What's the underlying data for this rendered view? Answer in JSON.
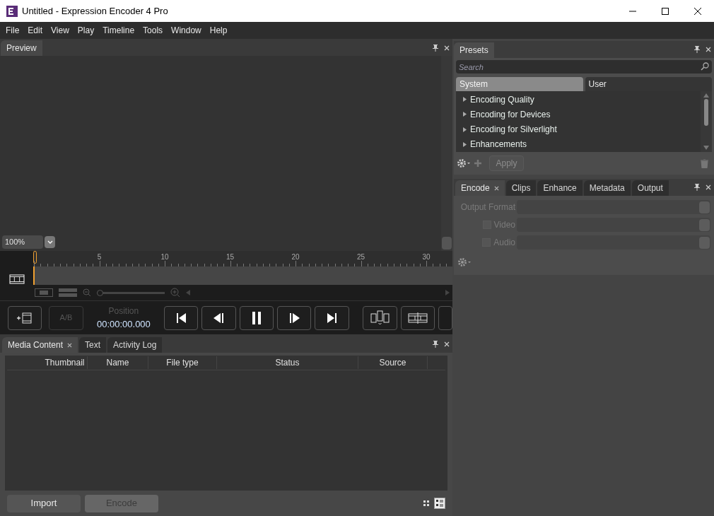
{
  "window": {
    "title": "Untitled - Expression Encoder 4 Pro"
  },
  "menu": [
    "File",
    "Edit",
    "View",
    "Play",
    "Timeline",
    "Tools",
    "Window",
    "Help"
  ],
  "preview": {
    "tab": "Preview",
    "zoom": "100%"
  },
  "timeline": {
    "ticks": [
      "5",
      "10",
      "15",
      "20",
      "25",
      "30"
    ],
    "zoom_slider": {
      "level": 0
    }
  },
  "transport": {
    "ab": {
      "label": "A/B",
      "disabled": true
    },
    "position_label": "Position",
    "position": "00:00:00.000"
  },
  "media": {
    "tabs": [
      {
        "label": "Media Content",
        "selected": true,
        "closable": true
      },
      {
        "label": "Text",
        "selected": false,
        "closable": false
      },
      {
        "label": "Activity Log",
        "selected": false,
        "closable": false
      }
    ],
    "columns": [
      "Thumbnail",
      "Name",
      "File type",
      "Status",
      "Source"
    ],
    "buttons": [
      {
        "label": "Import",
        "disabled": false
      },
      {
        "label": "Encode",
        "disabled": true
      }
    ]
  },
  "presets": {
    "tab": "Presets",
    "search": {
      "placeholder": "Search"
    },
    "tabs": [
      {
        "label": "System",
        "selected": true
      },
      {
        "label": "User",
        "selected": false
      }
    ],
    "items": [
      "Encoding Quality",
      "Encoding for Devices",
      "Encoding for Silverlight",
      "Enhancements"
    ],
    "apply": {
      "label": "Apply",
      "disabled": true
    }
  },
  "encode": {
    "tabs": [
      {
        "label": "Encode",
        "selected": true,
        "closable": true
      },
      {
        "label": "Clips",
        "selected": false,
        "closable": false
      },
      {
        "label": "Enhance",
        "selected": false,
        "closable": false
      },
      {
        "label": "Metadata",
        "selected": false,
        "closable": false
      },
      {
        "label": "Output",
        "selected": false,
        "closable": false
      }
    ],
    "fields": [
      {
        "kind": "label",
        "label": "Output Format"
      },
      {
        "kind": "checkbox",
        "label": "Video",
        "checked": false
      },
      {
        "kind": "checkbox",
        "label": "Audio",
        "checked": false
      }
    ]
  }
}
